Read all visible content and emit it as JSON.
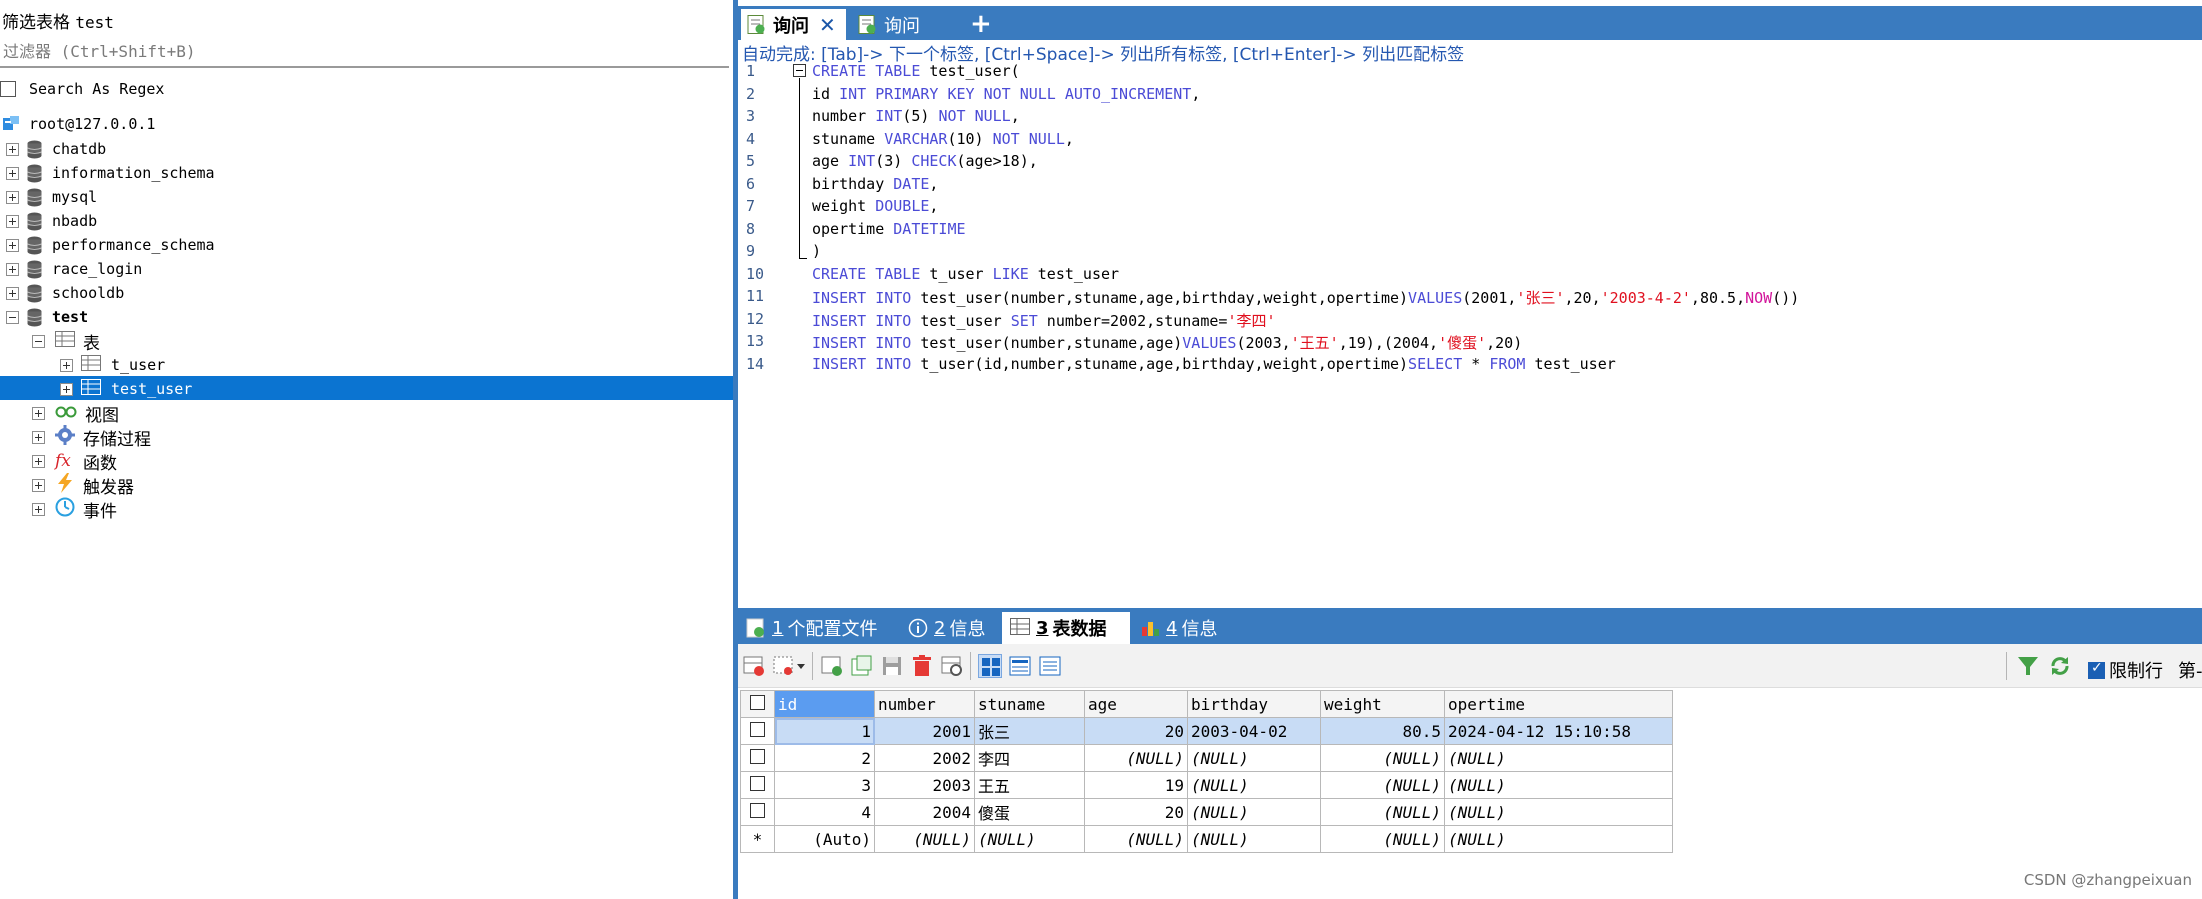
{
  "left_panel": {
    "filter_title": "筛选表格",
    "filter_table": "test",
    "filter_placeholder": "过滤器 (Ctrl+Shift+B)",
    "search_regex_label": "Search As Regex",
    "connection": "root@127.0.0.1",
    "databases": [
      "chatdb",
      "information_schema",
      "mysql",
      "nbadb",
      "performance_schema",
      "race_login",
      "schooldb",
      "test"
    ],
    "test_children": {
      "tables_label": "表",
      "tables": [
        "t_user",
        "test_user"
      ],
      "views_label": "视图",
      "procs_label": "存储过程",
      "funcs_label": "函数",
      "triggers_label": "触发器",
      "events_label": "事件"
    }
  },
  "editor_tabs": {
    "active_label": "询问",
    "active_close": "✕",
    "inactive_label": "询问",
    "add_label": "+"
  },
  "autocomplete_hint": "自动完成: [Tab]-> 下一个标签, [Ctrl+Space]-> 列出所有标签, [Ctrl+Enter]-> 列出匹配标签",
  "editor": {
    "line_numbers": [
      "1",
      "2",
      "3",
      "4",
      "5",
      "6",
      "7",
      "8",
      "9",
      "10",
      "11",
      "12",
      "13",
      "14"
    ],
    "lines": [
      "CREATE TABLE test_user(",
      "id INT PRIMARY KEY NOT NULL AUTO_INCREMENT,",
      "number INT(5) NOT NULL,",
      "stuname VARCHAR(10) NOT NULL,",
      "age INT(3) CHECK(age>18),",
      "birthday DATE,",
      "weight DOUBLE,",
      "opertime DATETIME",
      ")",
      "CREATE TABLE t_user LIKE test_user",
      "INSERT INTO test_user(number,stuname,age,birthday,weight,opertime)VALUES(2001,'张三',20,'2003-4-2',80.5,NOW())",
      "INSERT INTO test_user SET number=2002,stuname='李四'",
      "INSERT INTO test_user(number,stuname,age)VALUES(2003,'王五',19),(2004,'傻蛋',20)",
      "INSERT INTO t_user(id,number,stuname,age,birthday,weight,opertime)SELECT * FROM test_user"
    ]
  },
  "result_tabs": [
    {
      "num": "1",
      "label": "个配置文件"
    },
    {
      "num": "2",
      "label": "信息"
    },
    {
      "num": "3",
      "label": "表数据"
    },
    {
      "num": "4",
      "label": "信息"
    }
  ],
  "toolbar": {
    "limit_label": "限制行",
    "page_label": "第-"
  },
  "grid": {
    "columns": [
      "id",
      "number",
      "stuname",
      "age",
      "birthday",
      "weight",
      "opertime"
    ],
    "rows": [
      [
        "1",
        "2001",
        "张三",
        "20",
        "2003-04-02",
        "80.5",
        "2024-04-12 15:10:58"
      ],
      [
        "2",
        "2002",
        "李四",
        "(NULL)",
        "(NULL)",
        "(NULL)",
        "(NULL)"
      ],
      [
        "3",
        "2003",
        "王五",
        "19",
        "(NULL)",
        "(NULL)",
        "(NULL)"
      ],
      [
        "4",
        "2004",
        "傻蛋",
        "20",
        "(NULL)",
        "(NULL)",
        "(NULL)"
      ]
    ],
    "new_row": [
      "*",
      "(Auto)",
      "(NULL)",
      "(NULL)",
      "(NULL)",
      "(NULL)",
      "(NULL)",
      "(NULL)"
    ]
  },
  "watermark": "CSDN @zhangpeixuan",
  "colors": {
    "accent": "#3a7bbf",
    "selection": "#0b74d1",
    "keyword": "#4b4bd6",
    "string": "#e0101f",
    "function": "#d2149a"
  }
}
